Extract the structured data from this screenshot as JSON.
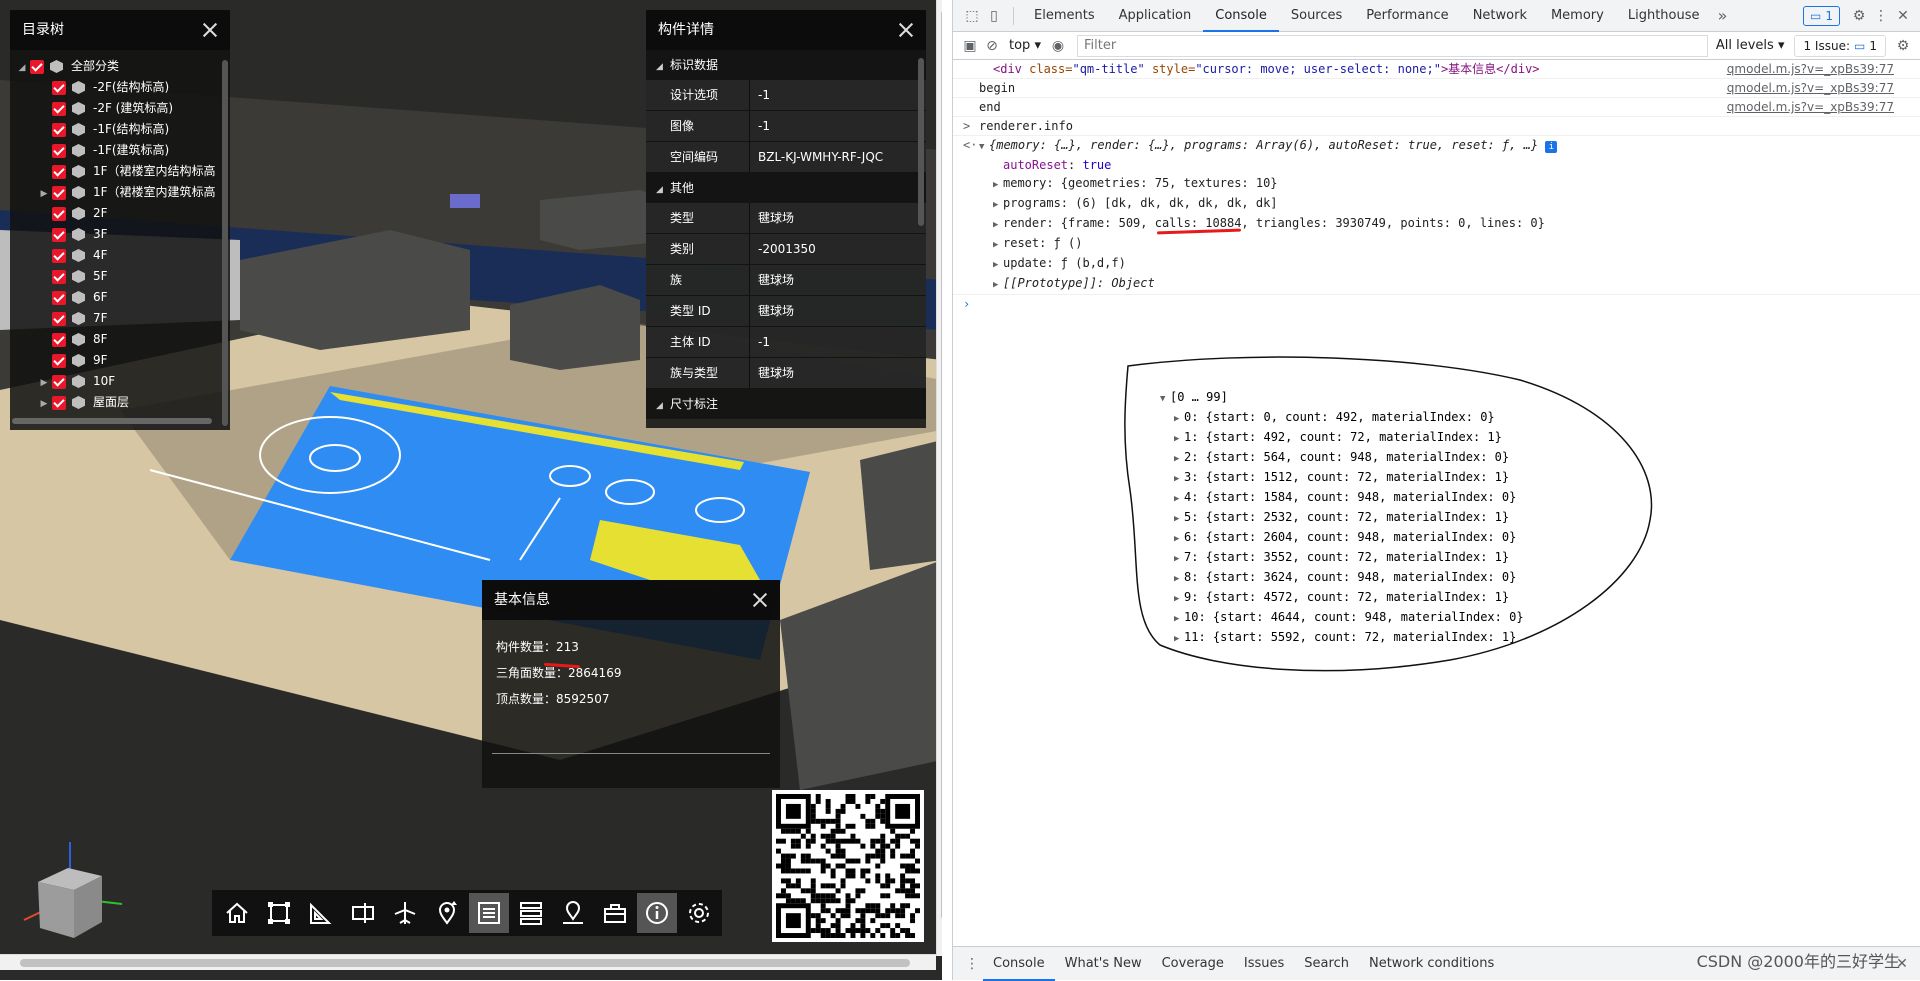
{
  "tree": {
    "title": "目录树",
    "root": "全部分类",
    "items": [
      "-2F(结构标高)",
      "-2F (建筑标高)",
      "-1F(结构标高)",
      "-1F(建筑标高)",
      "1F（裙楼室内结构标高",
      "1F（裙楼室内建筑标高",
      "2F",
      "3F",
      "4F",
      "5F",
      "6F",
      "7F",
      "8F",
      "9F",
      "10F",
      "屋面层"
    ]
  },
  "detail": {
    "title": "构件详情",
    "sections": {
      "identity": "标识数据",
      "other": "其他",
      "dims": "尺寸标注"
    },
    "identity_rows": [
      {
        "k": "设计选项",
        "v": "-1"
      },
      {
        "k": "图像",
        "v": "-1"
      },
      {
        "k": "空间编码",
        "v": "BZL-KJ-WMHY-RF-JQC"
      }
    ],
    "other_rows": [
      {
        "k": "类型",
        "v": "毽球场"
      },
      {
        "k": "类别",
        "v": "-2001350"
      },
      {
        "k": "族",
        "v": "毽球场"
      },
      {
        "k": "类型 ID",
        "v": "毽球场"
      },
      {
        "k": "主体 ID",
        "v": "-1"
      },
      {
        "k": "族与类型",
        "v": "毽球场"
      }
    ]
  },
  "info": {
    "title": "基本信息",
    "components_label": "构件数量：",
    "components": "213",
    "triangles_label": "三角面数量：",
    "triangles": "2864169",
    "vertices_label": "顶点数量：",
    "vertices": "8592507"
  },
  "toolbar": {
    "icons": [
      "home-icon",
      "box-select-icon",
      "measure-icon",
      "section-icon",
      "airplane-icon",
      "location-pin-icon",
      "list-icon",
      "layers-icon",
      "map-pin-icon",
      "toolbox-icon",
      "info-icon",
      "settings-icon"
    ]
  },
  "devtools": {
    "tabs": [
      "Elements",
      "Application",
      "Console",
      "Sources",
      "Performance",
      "Network",
      "Memory",
      "Lighthouse"
    ],
    "active_tab": "Console",
    "messages_count": "1",
    "context": "top",
    "filter_placeholder": "Filter",
    "levels": "All levels",
    "issues_label": "1 Issue:",
    "issues_count": "1",
    "lines": {
      "html_open": "<div",
      "html_attr1": " class=",
      "html_val1": "\"qm-title\"",
      "html_attr2": " style=",
      "html_val2": "\"cursor: move; user-select: none;\"",
      "html_text": ">基本信息</div>",
      "src": "qmodel.m.js?v=_xpBs39:77",
      "begin": "begin",
      "end": "end",
      "cmd": "renderer.info",
      "summary": "{memory: {…}, render: {…}, programs: Array(6), autoReset: true, reset: ƒ, …}",
      "autoReset_k": "autoReset",
      "autoReset_v": "true",
      "memory": "memory: {geometries: 75, textures: 10}",
      "programs": "programs: (6) [dk, dk, dk, dk, dk, dk]",
      "render": "render: {frame: 509, calls: 10884, triangles: 3930749, points: 0, lines: 0}",
      "reset": "reset: ƒ ()",
      "update": "update: ƒ (b,d,f)",
      "proto": "[[Prototype]]: Object"
    },
    "array_header": "[0 … 99]",
    "array_rows": [
      "0: {start: 0, count: 492, materialIndex: 0}",
      "1: {start: 492, count: 72, materialIndex: 1}",
      "2: {start: 564, count: 948, materialIndex: 0}",
      "3: {start: 1512, count: 72, materialIndex: 1}",
      "4: {start: 1584, count: 948, materialIndex: 0}",
      "5: {start: 2532, count: 72, materialIndex: 1}",
      "6: {start: 2604, count: 948, materialIndex: 0}",
      "7: {start: 3552, count: 72, materialIndex: 1}",
      "8: {start: 3624, count: 948, materialIndex: 0}",
      "9: {start: 4572, count: 72, materialIndex: 1}",
      "10: {start: 4644, count: 948, materialIndex: 0}",
      "11: {start: 5592, count: 72, materialIndex: 1}"
    ],
    "bottom_tabs": [
      "Console",
      "What's New",
      "Coverage",
      "Issues",
      "Search",
      "Network conditions"
    ],
    "watermark": "CSDN @2000年的三好学生"
  }
}
